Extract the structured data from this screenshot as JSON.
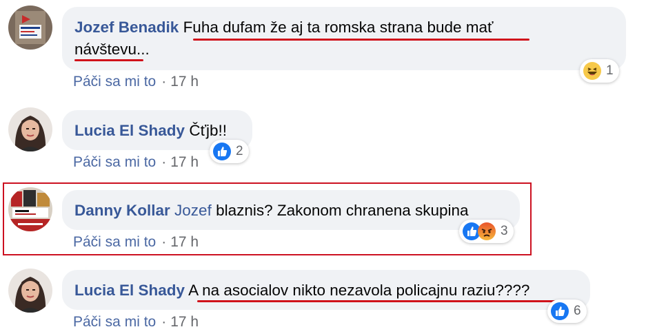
{
  "comments": [
    {
      "author": "Jozef Benadik",
      "text_line1": "Fuha dufam že aj ta romska strana bude mať",
      "text_line2": "návštevu...",
      "like_label": "Páči sa mi to",
      "separator": "·",
      "time": "17 h",
      "reaction_count": "1",
      "reaction_icons": [
        "haha-icon"
      ]
    },
    {
      "author": "Lucia El Shady",
      "text": "Čťjb!!",
      "like_label": "Páči sa mi to",
      "separator": "·",
      "time": "17 h",
      "reaction_count": "2",
      "reaction_icons": [
        "like-icon"
      ]
    },
    {
      "author": "Danny Kollar",
      "mention": "Jozef",
      "text": " blaznis? Zakonom chranena skupina",
      "like_label": "Páči sa mi to",
      "separator": "·",
      "time": "17 h",
      "reaction_count": "3",
      "reaction_icons": [
        "like-icon",
        "angry-icon"
      ]
    },
    {
      "author": "Lucia El Shady",
      "text": "A na asocialov nikto nezavola policajnu raziu????",
      "like_label": "Páči sa mi to",
      "separator": "·",
      "time": "17 h",
      "reaction_count": "6",
      "reaction_icons": [
        "like-icon"
      ]
    }
  ],
  "colors": {
    "author": "#385898",
    "bubble_bg": "#f0f2f5",
    "annotation_red": "#d0121b",
    "like_blue": "#1877f2"
  }
}
